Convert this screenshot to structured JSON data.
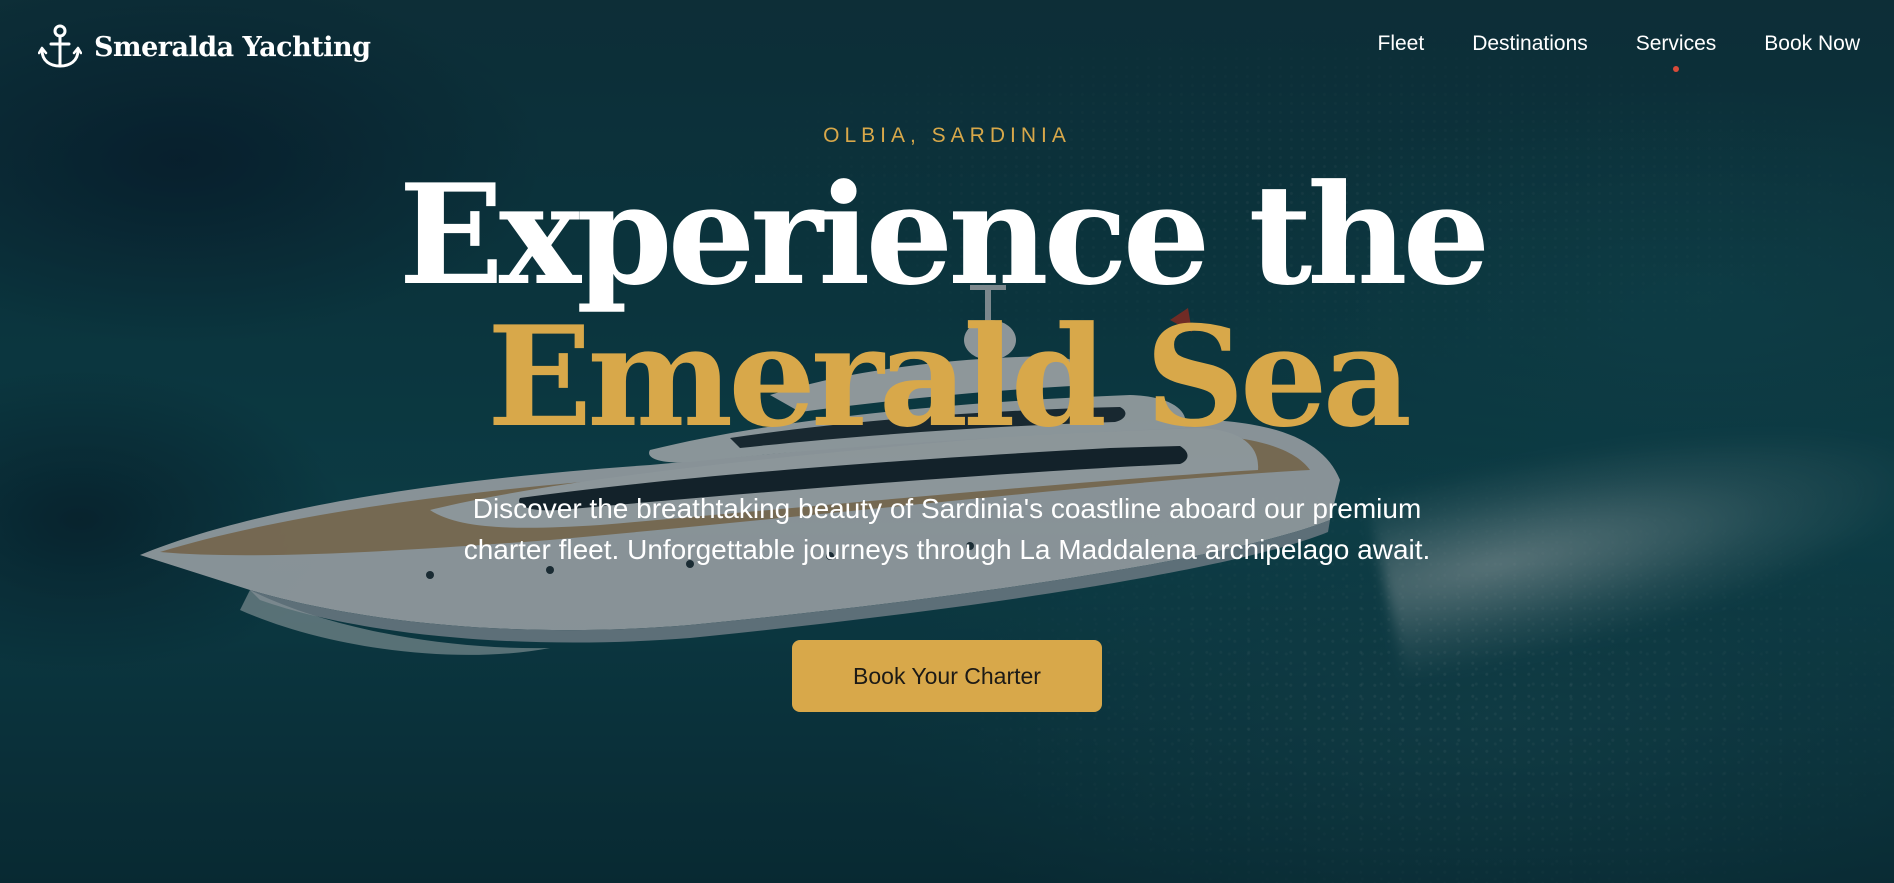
{
  "brand": {
    "name": "Smeralda Yachting",
    "icon": "anchor-icon"
  },
  "nav": {
    "items": [
      {
        "label": "Fleet",
        "active": false
      },
      {
        "label": "Destinations",
        "active": false
      },
      {
        "label": "Services",
        "active": true
      },
      {
        "label": "Book Now",
        "active": false
      }
    ]
  },
  "hero": {
    "eyebrow": "OLBIA, SARDINIA",
    "headline_line1": "Experience the",
    "headline_line2": "Emerald Sea",
    "subtitle": "Discover the breathtaking beauty of Sardinia's coastline aboard our premium charter fleet. Unforgettable journeys through La Maddalena archipelago await.",
    "cta_label": "Book Your Charter"
  },
  "colors": {
    "accent_gold": "#d8a84a",
    "active_indicator": "#d94b3a",
    "text_primary": "#ffffff",
    "sea": "#0f4a55"
  }
}
